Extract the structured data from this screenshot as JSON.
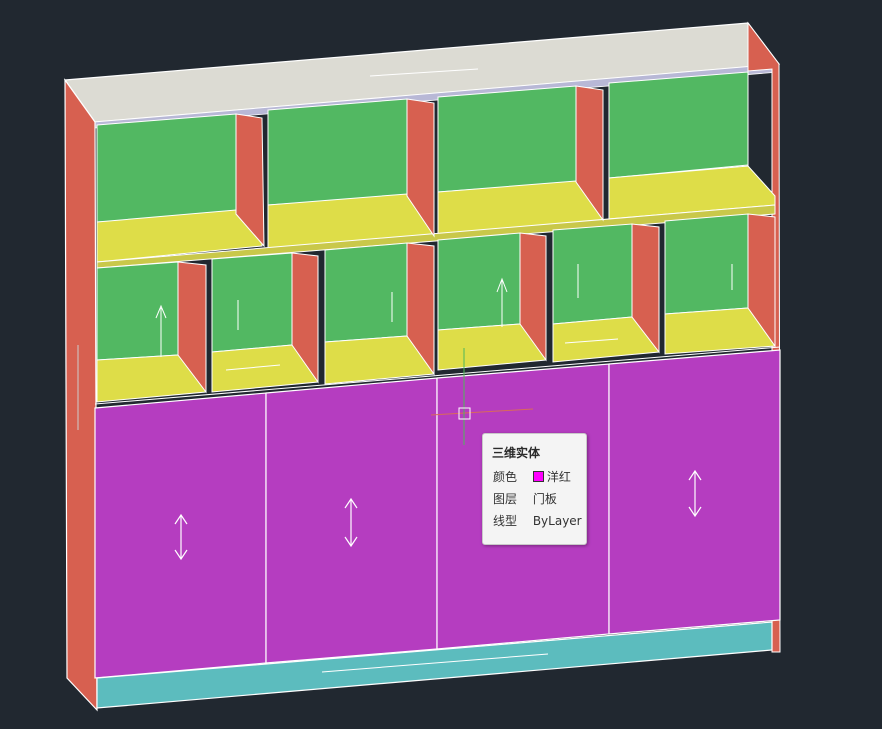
{
  "viewport": {
    "background": "#212830",
    "colors": {
      "top_panel": "#dcdbd3",
      "side_panel": "#d76050",
      "back_panel": "#52b862",
      "shelf": "#dedd48",
      "door": "#b53dc0",
      "plinth": "#5cbcbe"
    }
  },
  "cursor": {
    "name": "crosshair-pickbox"
  },
  "tooltip": {
    "title": "三维实体",
    "rows": [
      {
        "label": "颜色",
        "value": "洋红",
        "swatch": "#ff00ff"
      },
      {
        "label": "图层",
        "value": "门板"
      },
      {
        "label": "线型",
        "value": "ByLayer"
      }
    ]
  }
}
